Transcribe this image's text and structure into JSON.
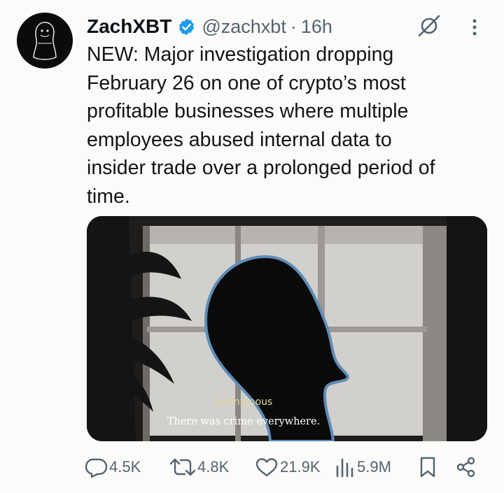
{
  "tweet": {
    "display_name": "ZachXBT",
    "handle": "@zachxbt",
    "separator": "·",
    "time": "16h",
    "text": "NEW: Major investigation dropping\nFebruary 26 on one of crypto’s most\nprofitable businesses where multiple\nemployees abused internal data to\ninsider trade over a prolonged period of\ntime.",
    "media": {
      "subtitle_name": "Anonymous",
      "subtitle_text": "There was crime everywhere."
    }
  },
  "actions": {
    "replies": "4.5K",
    "reposts": "4.8K",
    "likes": "21.9K",
    "views": "5.9M"
  },
  "colors": {
    "verified": "#1d9bf0",
    "secondary_text": "#536471",
    "subtitle_name": "#e3d79a"
  },
  "icons": [
    "verified-badge-icon",
    "grok-icon",
    "more-icon",
    "reply-icon",
    "repost-icon",
    "like-icon",
    "views-icon",
    "bookmark-icon",
    "share-icon"
  ]
}
